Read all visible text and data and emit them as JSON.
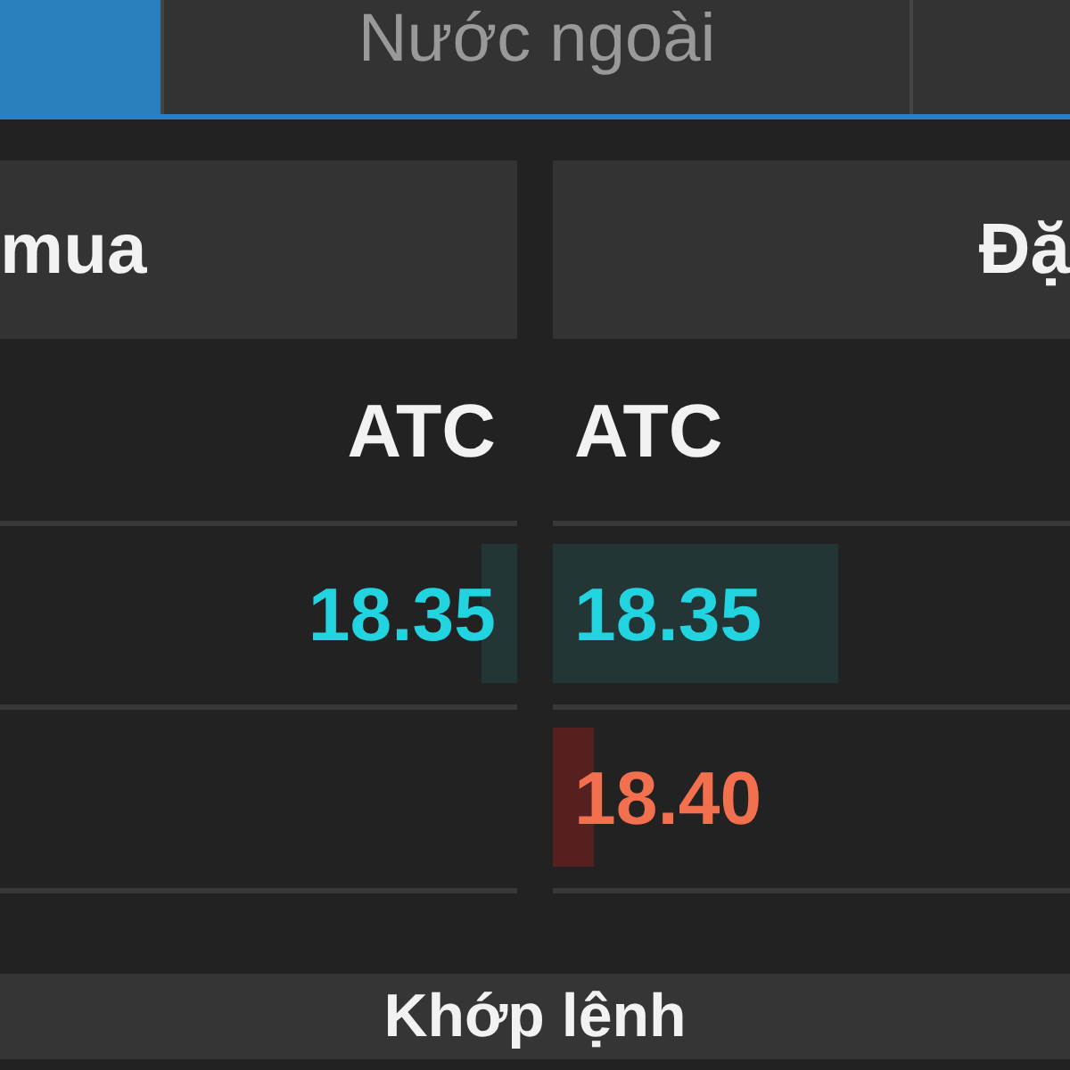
{
  "tabs": [
    {
      "selected": true
    },
    {
      "label": "Nước ngoài",
      "selected": false
    },
    {
      "selected": false
    }
  ],
  "headers": {
    "bid": "mua",
    "ask": "Đặ"
  },
  "rows": [
    {
      "bid": {
        "text": "ATC",
        "kind": "neutral"
      },
      "ask": {
        "text": "ATC",
        "kind": "neutral"
      }
    },
    {
      "bid": {
        "text": "18.35",
        "kind": "up",
        "level": 0.07
      },
      "ask": {
        "text": "18.35",
        "kind": "up",
        "level": 0.55
      }
    },
    {
      "ask": {
        "text": "18.40",
        "kind": "down",
        "level": 0.08
      }
    }
  ],
  "footer": {
    "label": "Khớp lệnh"
  }
}
